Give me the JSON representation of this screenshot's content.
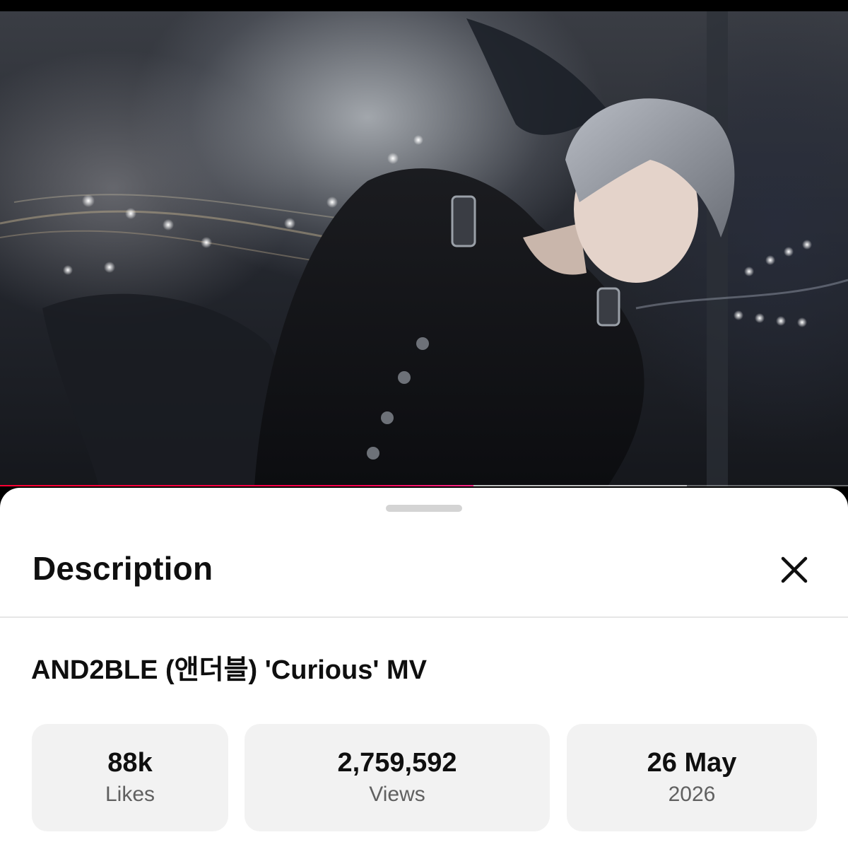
{
  "video": {
    "progress_played": 0.558,
    "progress_buffered": 0.81,
    "accent_color": "#ff0033"
  },
  "sheet": {
    "title": "Description",
    "close_icon": "close-icon"
  },
  "details": {
    "video_title": "AND2BLE (앤더블) 'Curious' MV",
    "stats": [
      {
        "value": "88k",
        "label": "Likes"
      },
      {
        "value": "2,759,592",
        "label": "Views"
      },
      {
        "value": "26 May",
        "label": "2026"
      }
    ]
  }
}
